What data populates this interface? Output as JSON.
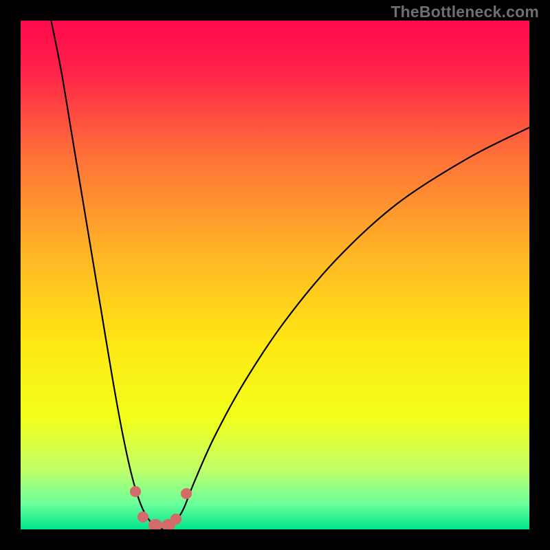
{
  "watermark": "TheBottleneck.com",
  "chart_data": {
    "type": "line",
    "title": "",
    "xlabel": "",
    "ylabel": "",
    "xlim": [
      0,
      100
    ],
    "ylim": [
      0,
      100
    ],
    "grid": false,
    "legend": false,
    "background": {
      "type": "vertical-gradient",
      "stops": [
        {
          "pos": 0.0,
          "color": "#ff0a4e"
        },
        {
          "pos": 0.1,
          "color": "#ff2349"
        },
        {
          "pos": 0.25,
          "color": "#ff6a3a"
        },
        {
          "pos": 0.45,
          "color": "#ffb327"
        },
        {
          "pos": 0.63,
          "color": "#ffe714"
        },
        {
          "pos": 0.78,
          "color": "#f2ff1a"
        },
        {
          "pos": 0.88,
          "color": "#c3ff66"
        },
        {
          "pos": 0.95,
          "color": "#6bff9c"
        },
        {
          "pos": 1.0,
          "color": "#00e58b"
        }
      ]
    },
    "series": [
      {
        "name": "left-branch",
        "stroke": "#000000",
        "points": [
          {
            "x": 6,
            "y": 100
          },
          {
            "x": 8,
            "y": 90
          },
          {
            "x": 10,
            "y": 78
          },
          {
            "x": 12,
            "y": 66
          },
          {
            "x": 14,
            "y": 54
          },
          {
            "x": 16,
            "y": 42
          },
          {
            "x": 18,
            "y": 30
          },
          {
            "x": 20,
            "y": 19
          },
          {
            "x": 22,
            "y": 10
          },
          {
            "x": 24,
            "y": 4
          },
          {
            "x": 26,
            "y": 1
          },
          {
            "x": 28,
            "y": 0
          }
        ]
      },
      {
        "name": "right-branch",
        "stroke": "#000000",
        "points": [
          {
            "x": 28,
            "y": 0
          },
          {
            "x": 30,
            "y": 1
          },
          {
            "x": 32,
            "y": 4
          },
          {
            "x": 34,
            "y": 9
          },
          {
            "x": 38,
            "y": 18
          },
          {
            "x": 44,
            "y": 29
          },
          {
            "x": 52,
            "y": 41
          },
          {
            "x": 62,
            "y": 53
          },
          {
            "x": 74,
            "y": 64
          },
          {
            "x": 88,
            "y": 73
          },
          {
            "x": 100,
            "y": 79
          }
        ]
      }
    ],
    "markers": {
      "color": "#d46a6a",
      "points": [
        {
          "x": 22.5,
          "y": 7.5
        },
        {
          "x": 24.0,
          "y": 2.5
        },
        {
          "x": 26.5,
          "y": 0.8
        },
        {
          "x": 29.0,
          "y": 0.8
        },
        {
          "x": 30.5,
          "y": 2.0
        },
        {
          "x": 32.5,
          "y": 7.0
        }
      ]
    }
  }
}
